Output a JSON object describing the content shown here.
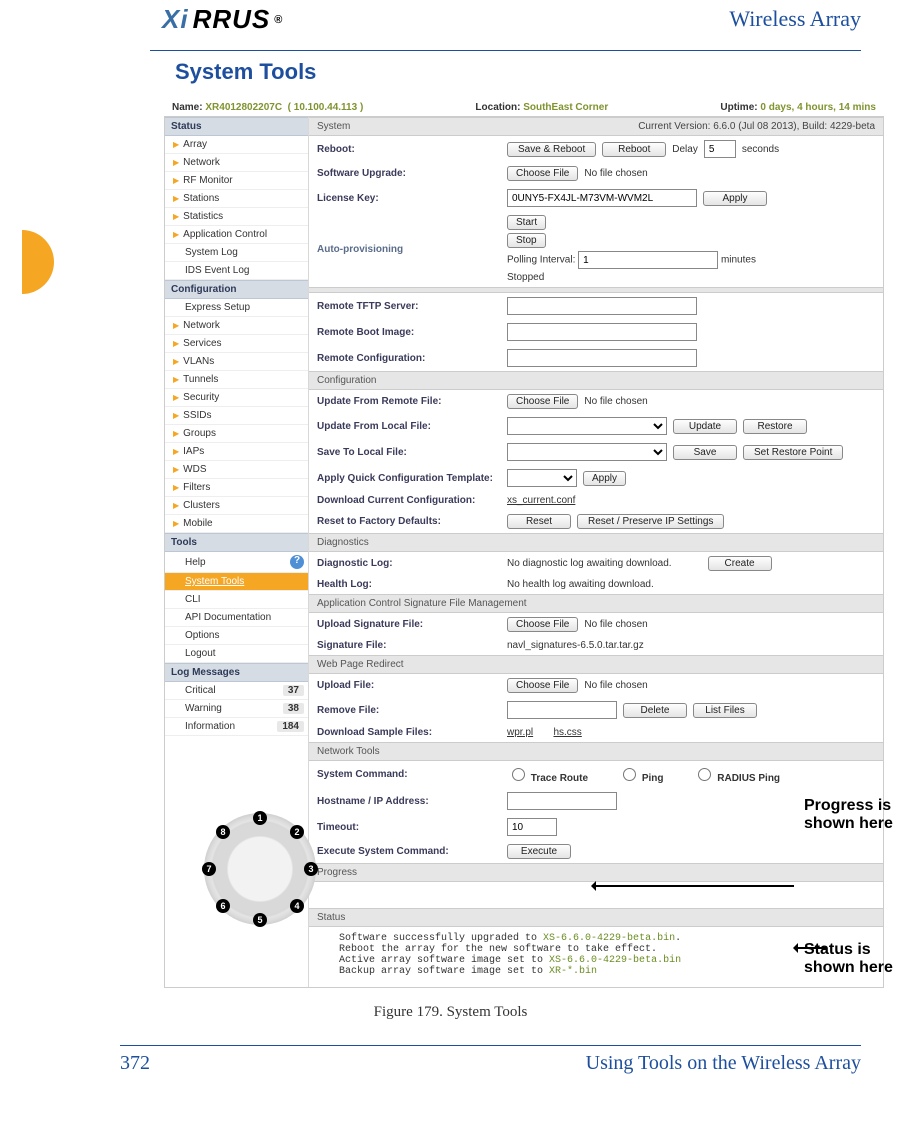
{
  "brand": {
    "left": "Xi",
    "right": "RRUS",
    "reg": "®"
  },
  "header_right": "Wireless Array",
  "section_title": "System Tools",
  "nav": {
    "status_hdr": "Status",
    "status_items": [
      "Array",
      "Network",
      "RF Monitor",
      "Stations",
      "Statistics",
      "Application Control"
    ],
    "status_sub": [
      "System Log",
      "IDS Event Log"
    ],
    "config_hdr": "Configuration",
    "config_items": [
      "Express Setup",
      "Network",
      "Services",
      "VLANs",
      "Tunnels",
      "Security",
      "SSIDs",
      "Groups",
      "IAPs",
      "WDS",
      "Filters",
      "Clusters",
      "Mobile"
    ],
    "tools_hdr": "Tools",
    "tools_items": {
      "help": "Help",
      "system_tools": "System Tools",
      "cli": "CLI",
      "api": "API Documentation",
      "options": "Options",
      "logout": "Logout"
    },
    "logs_hdr": "Log Messages",
    "logs": [
      {
        "label": "Critical",
        "count": "37"
      },
      {
        "label": "Warning",
        "count": "38"
      },
      {
        "label": "Information",
        "count": "184"
      }
    ]
  },
  "info": {
    "name_lbl": "Name:",
    "name": "XR4012802207C",
    "ip": "( 10.100.44.113 )",
    "loc_lbl": "Location:",
    "loc": "SouthEast Corner",
    "up_lbl": "Uptime:",
    "up": "0 days, 4 hours, 14 mins"
  },
  "system": {
    "hdr": "System",
    "ver": "Current Version: 6.6.0 (Jul 08 2013), Build: 4229-beta",
    "reboot_lbl": "Reboot:",
    "save_reboot_btn": "Save & Reboot",
    "reboot_btn": "Reboot",
    "delay_lbl": "Delay",
    "delay_val": "5",
    "delay_sec": "seconds",
    "upgrade_lbl": "Software Upgrade:",
    "choose": "Choose File",
    "nofile": "No file chosen",
    "license_lbl": "License Key:",
    "license_val": "0UNY5-FX4JL-M73VM-WVM2L",
    "apply_btn": "Apply",
    "autoprov_lbl": "Auto-provisioning",
    "start_btn": "Start",
    "stop_btn": "Stop",
    "poll_lbl": "Polling Interval:",
    "poll_val": "1",
    "poll_min": "minutes",
    "stopped": "Stopped"
  },
  "remote": {
    "tftp_lbl": "Remote TFTP Server:",
    "boot_lbl": "Remote Boot Image:",
    "conf_lbl": "Remote Configuration:"
  },
  "config": {
    "hdr": "Configuration",
    "upd_remote_lbl": "Update From Remote File:",
    "choose": "Choose File",
    "nofile": "No file chosen",
    "upd_local_lbl": "Update From Local File:",
    "update_btn": "Update",
    "restore_btn": "Restore",
    "save_local_lbl": "Save To Local File:",
    "save_btn": "Save",
    "setrp_btn": "Set Restore Point",
    "quick_lbl": "Apply Quick Configuration Template:",
    "apply_btn": "Apply",
    "dl_lbl": "Download Current Configuration:",
    "dl_file": "xs_current.conf",
    "reset_lbl": "Reset to Factory Defaults:",
    "reset_btn": "Reset",
    "reset_ip_btn": "Reset / Preserve IP Settings"
  },
  "diag": {
    "hdr": "Diagnostics",
    "diag_lbl": "Diagnostic Log:",
    "diag_txt": "No diagnostic log awaiting download.",
    "create_btn": "Create",
    "health_lbl": "Health Log:",
    "health_txt": "No health log awaiting download."
  },
  "acsfm": {
    "hdr": "Application Control Signature File Management",
    "upload_lbl": "Upload Signature File:",
    "choose": "Choose File",
    "nofile": "No file chosen",
    "sig_lbl": "Signature File:",
    "sig_val": "navl_signatures-6.5.0.tar.tar.gz"
  },
  "wpr": {
    "hdr": "Web Page Redirect",
    "upload_lbl": "Upload File:",
    "choose": "Choose File",
    "nofile": "No file chosen",
    "remove_lbl": "Remove File:",
    "delete_btn": "Delete",
    "list_btn": "List Files",
    "dl_lbl": "Download Sample Files:",
    "s1": "wpr.pl",
    "s2": "hs.css"
  },
  "nt": {
    "hdr": "Network Tools",
    "cmd_lbl": "System Command:",
    "r1": "Trace Route",
    "r2": "Ping",
    "r3": "RADIUS Ping",
    "host_lbl": "Hostname / IP Address:",
    "timeout_lbl": "Timeout:",
    "timeout_val": "10",
    "exec_lbl": "Execute System Command:",
    "exec_btn": "Execute"
  },
  "progress_hdr": "Progress",
  "status_hdr": "Status",
  "status_text": {
    "l1a": "Software successfully upgraded to ",
    "l1b": "XS-6.6.0-4229-beta.bin",
    "l1c": ".",
    "l2": "Reboot the array for the new software to take effect.",
    "l3a": "Active array software image set to ",
    "l3b": "XS-6.6.0-4229-beta.bin",
    "l4a": "Backup array software image set to ",
    "l4b": "XR-*.bin"
  },
  "annot": {
    "progress": "Progress is shown here",
    "status": "Status is shown here"
  },
  "figure_caption": "Figure 179. System Tools",
  "footer": {
    "page": "372",
    "chapter": "Using Tools on the Wireless Array"
  }
}
